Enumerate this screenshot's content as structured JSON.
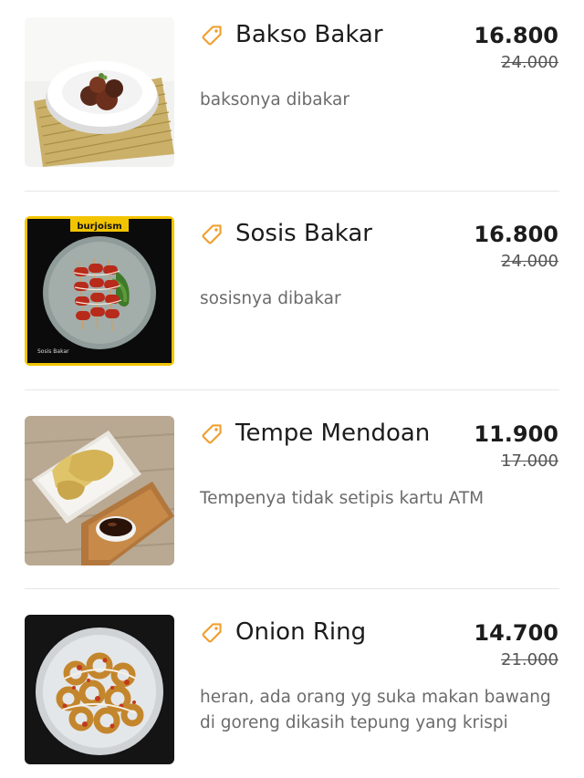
{
  "menu": {
    "items": [
      {
        "name": "Bakso Bakar",
        "price": "16.800",
        "original_price": "24.000",
        "description": "baksonya dibakar",
        "image": "bakso-bakar-photo"
      },
      {
        "name": "Sosis Bakar",
        "price": "16.800",
        "original_price": "24.000",
        "description": "sosisnya dibakar",
        "image": "sosis-bakar-photo",
        "image_label": "burjoism",
        "image_caption": "Sosis Bakar"
      },
      {
        "name": "Tempe Mendoan",
        "price": "11.900",
        "original_price": "17.000",
        "description": "Tempenya tidak setipis kartu ATM",
        "image": "tempe-mendoan-photo"
      },
      {
        "name": "Onion Ring",
        "price": "14.700",
        "original_price": "21.000",
        "description": "heran, ada orang yg suka makan bawang di goreng dikasih tepung yang krispi",
        "image": "onion-ring-photo"
      }
    ]
  },
  "colors": {
    "tag_icon": "#f0a030",
    "text_primary": "#1c1c1c",
    "text_secondary": "#6b6b6b",
    "divider": "#e6e6e6"
  }
}
